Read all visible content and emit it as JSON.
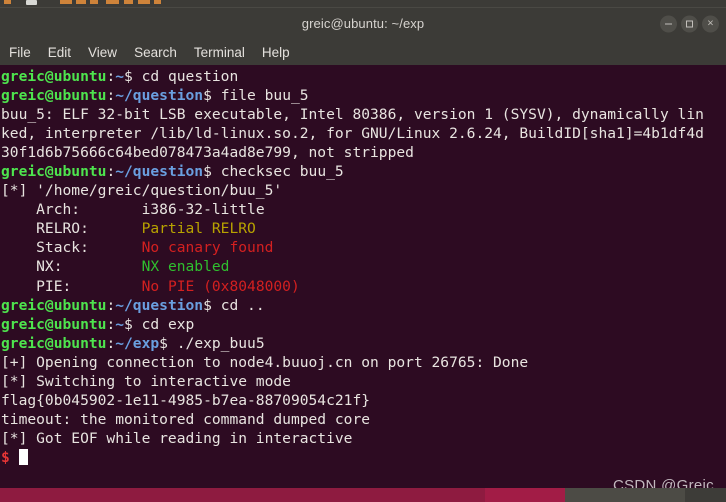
{
  "window": {
    "title": "greic@ubuntu: ~/exp",
    "controls": [
      {
        "name": "minimize",
        "label": "–"
      },
      {
        "name": "maximize",
        "label": "□"
      },
      {
        "name": "close",
        "label": "×"
      }
    ]
  },
  "menubar": {
    "items": [
      "File",
      "Edit",
      "View",
      "Search",
      "Terminal",
      "Help"
    ]
  },
  "terminal": {
    "prompt_user_host": "greic@ubuntu",
    "colors": {
      "background": "#2d0b22",
      "foreground": "#e8e4e0",
      "prompt_green": "#4ee44e",
      "path_blue": "#6a9fe0",
      "red": "#d32020",
      "yellow": "#b8a300",
      "green": "#2fbf2f"
    },
    "lines": [
      {
        "type": "prompt",
        "path": "~",
        "command": "cd question"
      },
      {
        "type": "prompt",
        "path": "~/question",
        "command": "file buu_5"
      },
      {
        "type": "output",
        "text": "buu_5: ELF 32-bit LSB executable, Intel 80386, version 1 (SYSV), dynamically lin"
      },
      {
        "type": "output",
        "text": "ked, interpreter /lib/ld-linux.so.2, for GNU/Linux 2.6.24, BuildID[sha1]=4b1df4d"
      },
      {
        "type": "output",
        "text": "30f1d6b75666c64bed078473a4ad8e799, not stripped"
      },
      {
        "type": "prompt",
        "path": "~/question",
        "command": "checksec buu_5"
      },
      {
        "type": "output",
        "text": "[*] '/home/greic/question/buu_5'"
      },
      {
        "type": "checksec",
        "label": "    Arch:",
        "value": "i386-32-little",
        "color": "white"
      },
      {
        "type": "checksec",
        "label": "    RELRO:",
        "value": "Partial RELRO",
        "color": "yellow"
      },
      {
        "type": "checksec",
        "label": "    Stack:",
        "value": "No canary found",
        "color": "red"
      },
      {
        "type": "checksec",
        "label": "    NX:",
        "value": "NX enabled",
        "color": "green"
      },
      {
        "type": "checksec",
        "label": "    PIE:",
        "value": "No PIE (0x8048000)",
        "color": "red"
      },
      {
        "type": "prompt",
        "path": "~/question",
        "command": "cd .."
      },
      {
        "type": "prompt",
        "path": "~",
        "command": "cd exp"
      },
      {
        "type": "prompt",
        "path": "~/exp",
        "command": "./exp_buu5"
      },
      {
        "type": "output",
        "text": "[+] Opening connection to node4.buuoj.cn on port 26765: Done"
      },
      {
        "type": "output",
        "text": "[*] Switching to interactive mode"
      },
      {
        "type": "output",
        "text": "flag{0b045902-1e11-4985-b7ea-88709054c21f}"
      },
      {
        "type": "output",
        "text": "timeout: the monitored command dumped core"
      },
      {
        "type": "output",
        "text": "[*] Got EOF while reading in interactive"
      }
    ],
    "final_prompt": "$"
  },
  "watermark": {
    "text": "CSDN @Greic"
  }
}
